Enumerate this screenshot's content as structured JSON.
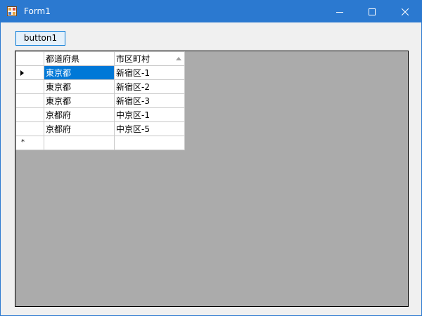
{
  "window": {
    "title": "Form1",
    "colors": {
      "titlebar": "#2b79d0",
      "selection": "#0078d7",
      "grid_background": "#ababab"
    }
  },
  "toolbar": {
    "button1_label": "button1"
  },
  "grid": {
    "columns": [
      "都道府県",
      "市区町村"
    ],
    "sorted_column": 1,
    "rows": [
      {
        "prefecture": "東京都",
        "city": "新宿区-1",
        "current": true
      },
      {
        "prefecture": "東京都",
        "city": "新宿区-2"
      },
      {
        "prefecture": "東京都",
        "city": "新宿区-3"
      },
      {
        "prefecture": "京都府",
        "city": "中京区-1"
      },
      {
        "prefecture": "京都府",
        "city": "中京区-5"
      }
    ],
    "new_row_marker": "*"
  }
}
